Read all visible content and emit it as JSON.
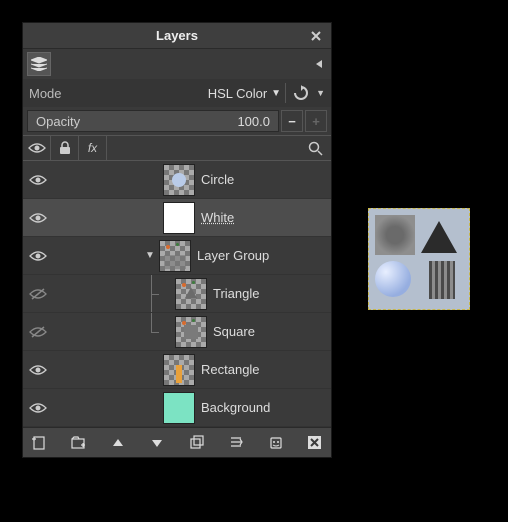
{
  "title": "Layers",
  "mode": {
    "label": "Mode",
    "value": "HSL Color"
  },
  "opacity": {
    "label": "Opacity",
    "value": "100.0"
  },
  "layers": [
    {
      "name": "Circle"
    },
    {
      "name": "White"
    },
    {
      "name": "Layer Group"
    },
    {
      "name": "Triangle"
    },
    {
      "name": "Square"
    },
    {
      "name": "Rectangle"
    },
    {
      "name": "Background"
    }
  ]
}
